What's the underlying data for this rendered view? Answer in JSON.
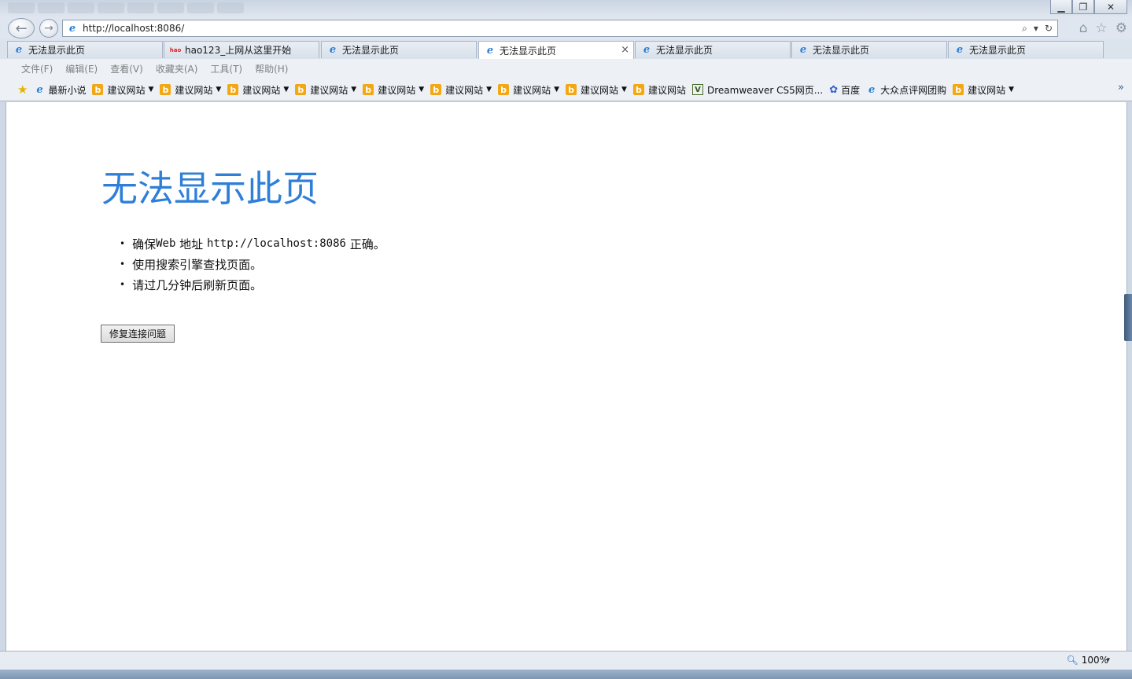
{
  "window": {
    "minimize": "▁",
    "restore": "❐",
    "close": "✕"
  },
  "nav": {
    "back": "←",
    "forward": "→",
    "address": "http://localhost:8086/",
    "search_icon": "⌕",
    "dropdown_icon": "▾",
    "refresh_icon": "↻",
    "home_icon": "⌂",
    "favorites_icon": "☆",
    "tools_icon": "⚙"
  },
  "tabs": [
    {
      "label": "无法显示此页",
      "icon": "ie-icon"
    },
    {
      "label": "hao123_上网从这里开始",
      "icon": "hao-icon"
    },
    {
      "label": "无法显示此页",
      "icon": "ie-icon"
    },
    {
      "label": "无法显示此页",
      "icon": "ie-icon",
      "active": true,
      "close": "×"
    },
    {
      "label": "无法显示此页",
      "icon": "ie-icon"
    },
    {
      "label": "无法显示此页",
      "icon": "ie-icon"
    },
    {
      "label": "无法显示此页",
      "icon": "ie-icon"
    }
  ],
  "menu": [
    "文件(F)",
    "编辑(E)",
    "查看(V)",
    "收藏夹(A)",
    "工具(T)",
    "帮助(H)"
  ],
  "favorites": [
    {
      "label": "最新小说",
      "icon": "ie-icon",
      "dropdown": false
    },
    {
      "label": "建议网站",
      "icon": "bing-icon",
      "dropdown": true
    },
    {
      "label": "建议网站",
      "icon": "bing-icon",
      "dropdown": true
    },
    {
      "label": "建议网站",
      "icon": "bing-icon",
      "dropdown": true
    },
    {
      "label": "建议网站",
      "icon": "bing-icon",
      "dropdown": true
    },
    {
      "label": "建议网站",
      "icon": "bing-icon",
      "dropdown": true
    },
    {
      "label": "建议网站",
      "icon": "bing-icon",
      "dropdown": true
    },
    {
      "label": "建议网站",
      "icon": "bing-icon",
      "dropdown": true
    },
    {
      "label": "建议网站",
      "icon": "bing-icon",
      "dropdown": true
    },
    {
      "label": "建议网站",
      "icon": "bing-icon",
      "dropdown": false
    },
    {
      "label": "Dreamweaver CS5网页...",
      "icon": "dreamweaver-icon",
      "dropdown": false
    },
    {
      "label": "百度",
      "icon": "baidu-paw-icon",
      "dropdown": false
    },
    {
      "label": "大众点评网团购",
      "icon": "ie-icon",
      "dropdown": false
    },
    {
      "label": "建议网站",
      "icon": "bing-icon",
      "dropdown": true
    }
  ],
  "favbar_more": "»",
  "page": {
    "title": "无法显示此页",
    "items": [
      {
        "pre": "确保 ",
        "mono1": "Web",
        "mid": " 地址 ",
        "mono2": "http://localhost:8086",
        "post": " 正确。"
      },
      {
        "pre": "使用搜索引擎查找页面。"
      },
      {
        "pre": "请过几分钟后刷新页面。"
      }
    ],
    "fix_button": "修复连接问题"
  },
  "status": {
    "zoom": "100%",
    "zoom_caret": "▾"
  },
  "colors": {
    "title": "#2f7fd8",
    "chrome": "#dfe6ef",
    "bing": "#f3a712"
  }
}
